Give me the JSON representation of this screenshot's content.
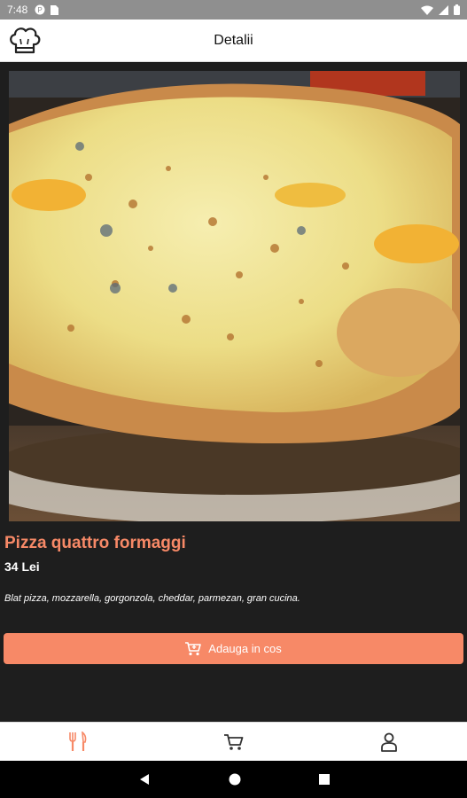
{
  "status_bar": {
    "time": "7:48"
  },
  "app_bar": {
    "title": "Detalii"
  },
  "product": {
    "name": "Pizza quattro formaggi",
    "price": "34 Lei",
    "description": "Blat pizza, mozzarella, gorgonzola, cheddar, parmezan, gran cucina."
  },
  "actions": {
    "add_to_cart_label": "Adauga in cos"
  },
  "bottom_nav": {
    "items": [
      "menu",
      "cart",
      "profile"
    ],
    "active": "menu"
  },
  "colors": {
    "accent": "#f78967",
    "background": "#1e1e1e",
    "status_bar": "#8f8f8f"
  },
  "icons": [
    "chef-hat-icon",
    "cart-icon",
    "utensils-icon",
    "user-icon"
  ]
}
